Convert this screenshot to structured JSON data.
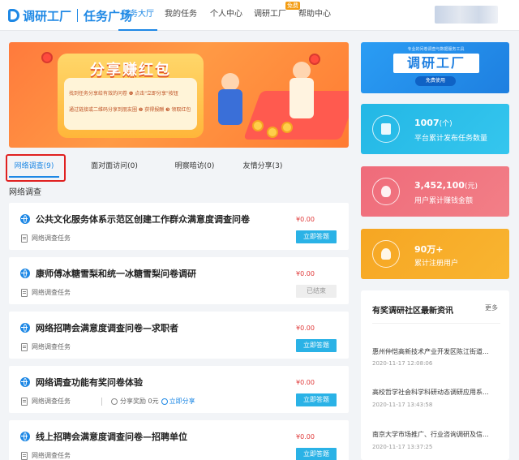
{
  "header": {
    "logo_text": "调研工厂",
    "logo_sub": "任务广场",
    "nav": [
      {
        "label": "任务大厅",
        "active": true,
        "badge": ""
      },
      {
        "label": "我的任务",
        "active": false,
        "badge": ""
      },
      {
        "label": "个人中心",
        "active": false,
        "badge": ""
      },
      {
        "label": "调研工厂",
        "active": false,
        "badge": "免费"
      },
      {
        "label": "帮助中心",
        "active": false,
        "badge": ""
      }
    ]
  },
  "banner": {
    "title": "分享赚红包",
    "lines": [
      "找到任务分享给有效的问卷 ❶ 点击\"立即分享\"按钮",
      "通过链接或二维码分享到朋友圈 ❷ 获得报酬 ❸ 领取红包"
    ]
  },
  "tabs": [
    {
      "label": "网络调查(9)",
      "active": true
    },
    {
      "label": "面对面访问(0)",
      "active": false
    },
    {
      "label": "明察暗访(0)",
      "active": false
    },
    {
      "label": "友情分享(3)",
      "active": false
    }
  ],
  "section_title": "网络调查",
  "tasks": [
    {
      "title": "公共文化服务体系示范区创建工作群众满意度调查问卷",
      "type": "网络调查任务",
      "price": "¥0.00",
      "button": "立即答题",
      "ended": false
    },
    {
      "title": "康师傅冰糖雪梨和统一冰糖雪梨问卷调研",
      "type": "网络调查任务",
      "price": "¥0.00",
      "button": "已结束",
      "ended": true
    },
    {
      "title": "网络招聘会满意度调查问卷—求职者",
      "type": "网络调查任务",
      "price": "¥0.00",
      "button": "立即答题",
      "ended": false
    },
    {
      "title": "网络调查功能有奖问卷体验",
      "type": "网络调查任务",
      "price": "¥0.00",
      "button": "立即答题",
      "ended": false,
      "share": {
        "label": "分享奖励",
        "amount": "0元",
        "link": "立即分享"
      }
    },
    {
      "title": "线上招聘会满意度调查问卷—招聘单位",
      "type": "网络调查任务",
      "price": "¥0.00",
      "button": "立即答题",
      "ended": false
    }
  ],
  "brand_card": {
    "tagline": "专业的问卷调查与数据服务工具",
    "title": "调研工厂",
    "button": "免费使用"
  },
  "stats": [
    {
      "num": "1007",
      "unit": "(个)",
      "label": "平台累计发布任务数量",
      "icon": "document-icon"
    },
    {
      "num": "3,452,100",
      "unit": "(元)",
      "label": "用户累计赚钱金额",
      "icon": "money-bag-icon"
    },
    {
      "num": "90万+",
      "unit": "",
      "label": "累计注册用户",
      "icon": "user-icon"
    }
  ],
  "news": {
    "title": "有奖调研社区最新资讯",
    "more": "更多",
    "items": [
      {
        "title": "惠州仲恺高新技术产业开发区陈江街道...",
        "date": "2020-11-17 12:08:06"
      },
      {
        "title": "高校哲学社会科学科研动态调研应用系...",
        "date": "2020-11-17 13:43:58"
      },
      {
        "title": "南京大学市场推广、行业咨询调研及信...",
        "date": "2020-11-17 13:37:25"
      }
    ]
  }
}
